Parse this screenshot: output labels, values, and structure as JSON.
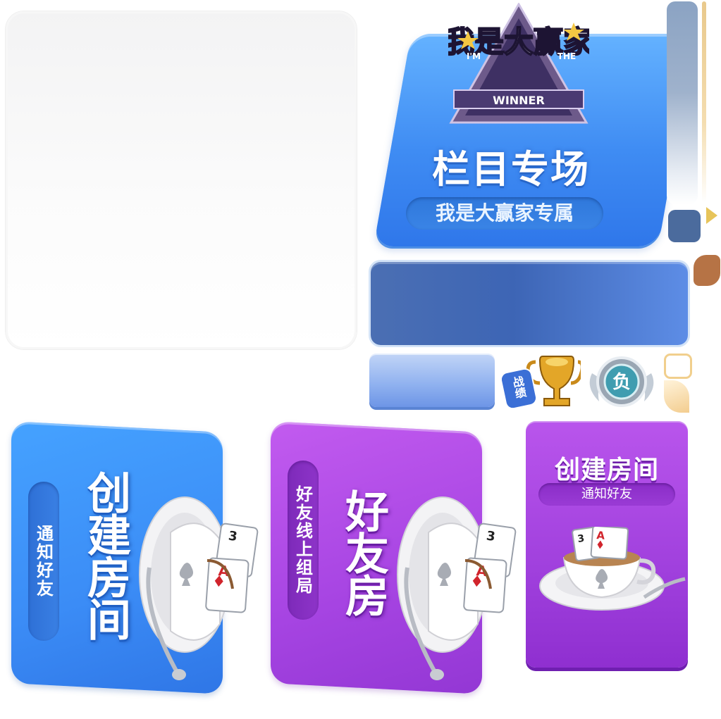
{
  "winner_card": {
    "logo_main": "我是大赢家",
    "logo_im": "I'M",
    "logo_the": "THE",
    "logo_winner": "WINNER",
    "title": "栏目专场",
    "subtitle": "我是大赢家专属"
  },
  "icons": {
    "record_label": "战绩",
    "loss_label": "负"
  },
  "create_room_card": {
    "title": "创建房间",
    "subtitle": "通知好友"
  },
  "friend_room_card": {
    "title": "好友房",
    "subtitle": "好友线上组局"
  },
  "create_room_small": {
    "title": "创建房间",
    "subtitle": "通知好友"
  },
  "cards": {
    "rank3": "3",
    "rankA": "A"
  },
  "colors": {
    "blue": "#3b8cf6",
    "purple": "#a644e2",
    "navy": "#4b6b9d",
    "gold": "#e7c45a",
    "brown": "#b67345"
  }
}
